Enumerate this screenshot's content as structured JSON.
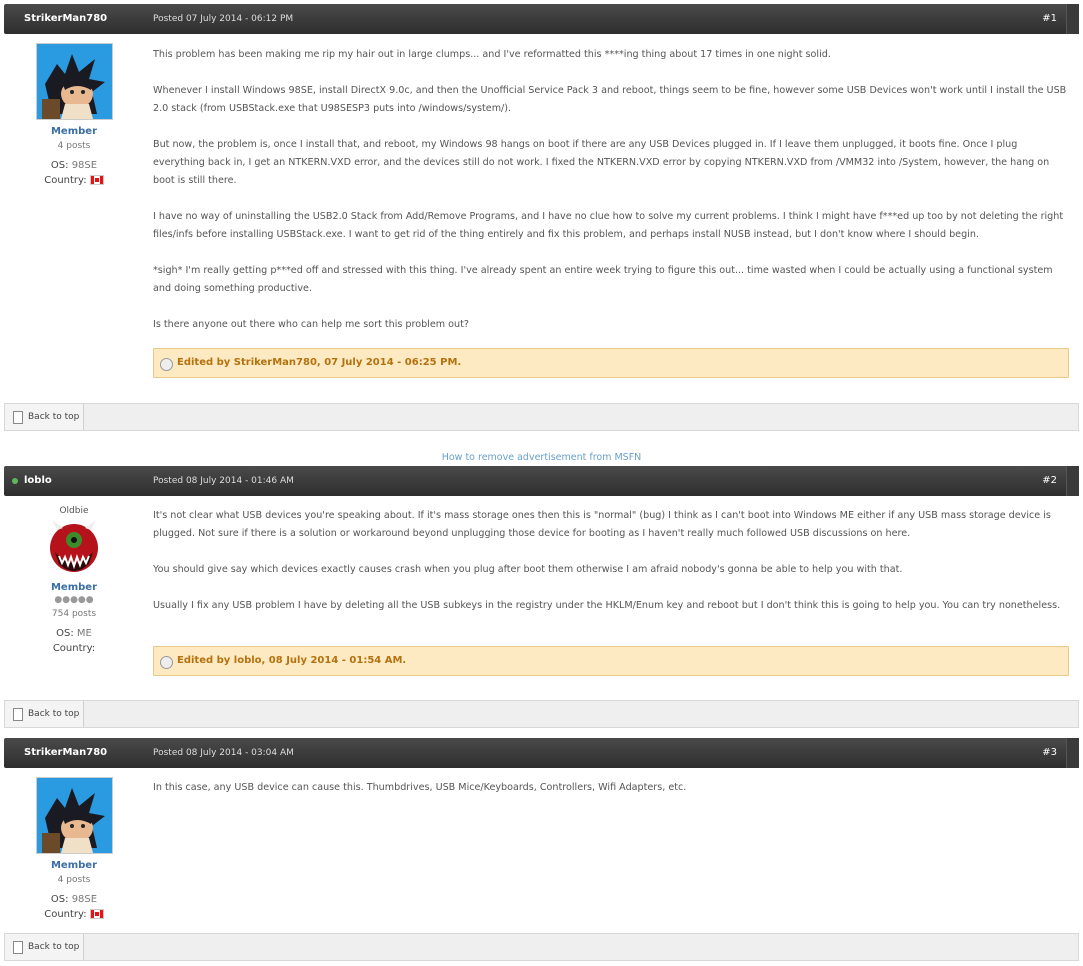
{
  "posts": [
    {
      "author": "StrikerMan780",
      "posted": "Posted 07 July 2014 - 06:12 PM",
      "number": "#1",
      "group": "Member",
      "posts_count": "4 posts",
      "os_label": "OS:",
      "os_value": "98SE",
      "country_label": "Country:",
      "paragraphs": [
        "This problem has been making me rip my hair out in large clumps... and I've reformatted this ****ing thing about 17 times in one night solid.",
        "Whenever I install Windows 98SE, install DirectX 9.0c, and then the Unofficial Service Pack 3 and reboot, things seem to be fine, however some USB Devices won't work until I install the USB 2.0 stack (from USBStack.exe that U98SESP3 puts into /windows/system/).",
        "But now, the problem is, once I install that, and reboot, my Windows 98 hangs on boot if there are any USB Devices plugged in. If I leave them unplugged, it boots fine. Once I plug everything back in, I get an NTKERN.VXD error, and the devices still do not work. I fixed the NTKERN.VXD error by copying NTKERN.VXD from /VMM32 into /System, however, the hang on boot is still there.",
        "I have no way of uninstalling the USB2.0 Stack from Add/Remove Programs, and I have no clue how to solve my current problems. I think I might have f***ed up too by not deleting the right files/infs before installing USBStack.exe. I want to get rid of the thing entirely and fix this problem, and perhaps install NUSB instead, but I don't know where I should begin.",
        "*sigh* I'm really getting p***ed off and stressed with this thing. I've already spent an entire week trying to figure this out... time wasted when I could be actually using a functional system and doing something productive.",
        "Is there anyone out there who can help me sort this problem out?"
      ],
      "edited": "Edited by StrikerMan780, 07 July 2014 - 06:25 PM.",
      "back_to_top": "Back to top"
    },
    {
      "author": "loblo",
      "posted": "Posted 08 July 2014 - 01:46 AM",
      "number": "#2",
      "title": "Oldbie",
      "group": "Member",
      "pips": "●●●●●",
      "posts_count": "754 posts",
      "os_label": "OS:",
      "os_value": "ME",
      "country_label": "Country:",
      "paragraphs": [
        "It's not clear what USB devices you're speaking about. If it's mass storage ones then this is \"normal\" (bug) I think as I can't boot into Windows ME either if any USB mass storage device is plugged. Not sure if there is a solution or workaround beyond unplugging those device for booting as I haven't really much followed USB discussions on here.",
        "You should give say which devices exactly causes crash when you plug  after boot them otherwise I am afraid nobody's gonna be able to help you with that.",
        "Usually I fix any USB problem I have by deleting all the USB subkeys in the registry under the HKLM/Enum key and reboot but I don't think this is going to help you. You can try nonetheless."
      ],
      "edited": "Edited by loblo, 08 July 2014 - 01:54 AM.",
      "back_to_top": "Back to top"
    },
    {
      "author": "StrikerMan780",
      "posted": "Posted 08 July 2014 - 03:04 AM",
      "number": "#3",
      "group": "Member",
      "posts_count": "4 posts",
      "os_label": "OS:",
      "os_value": "98SE",
      "country_label": "Country:",
      "paragraphs": [
        "In this case, any USB device can cause this. Thumbdrives, USB Mice/Keyboards, Controllers, Wifi Adapters, etc."
      ],
      "back_to_top": "Back to top"
    }
  ],
  "ad_link": "How to remove advertisement from MSFN",
  "colors": {
    "header_bg": "#3a3a3a",
    "online": "#5cb85c",
    "link": "#3a6ea5",
    "edit_bg": "#fde9c2",
    "edit_text": "#b4720f"
  }
}
